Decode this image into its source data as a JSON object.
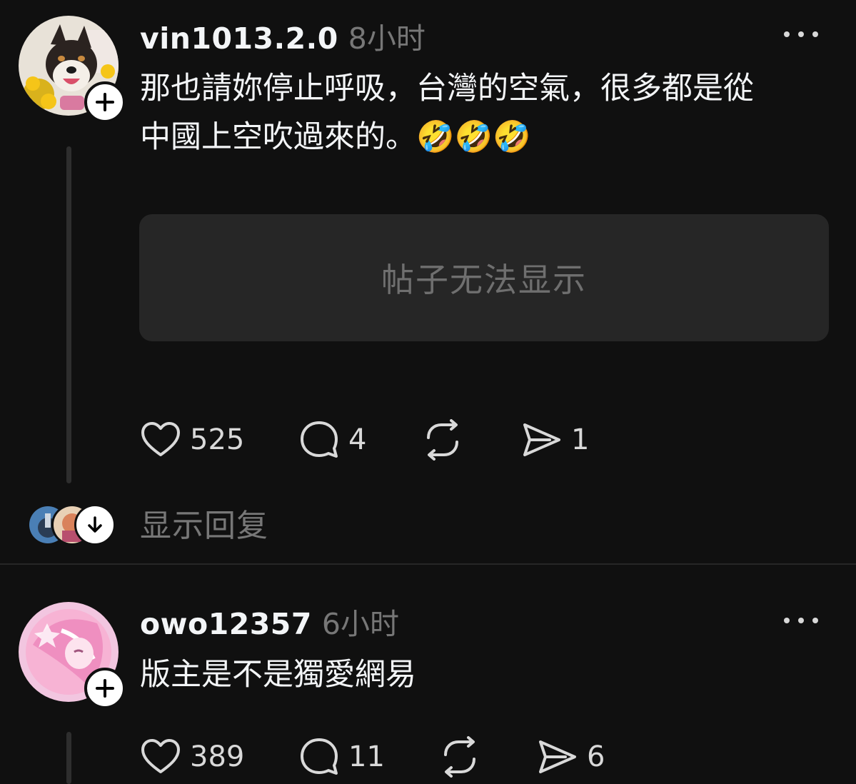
{
  "posts": [
    {
      "username": "vin1013.2.0",
      "time": "8小时",
      "text_line1": "那也請妳停止呼吸，台灣的空氣，很多都是從",
      "text_line2": "中國上空吹過來的。",
      "emojis": "🤣🤣🤣",
      "embedded_notice": "帖子无法显示",
      "likes": "525",
      "comments": "4",
      "reposts": "",
      "shares": "1",
      "show_replies_label": "显示回复"
    },
    {
      "username": "owo12357",
      "time": "6小时",
      "text": "版主是不是獨愛網易",
      "likes": "389",
      "comments": "11",
      "reposts": "",
      "shares": "6"
    }
  ],
  "icons": {
    "like": "heart-icon",
    "comment": "comment-bubble-icon",
    "repost": "repost-icon",
    "share": "send-icon",
    "follow": "plus-icon",
    "more": "more-dots-icon",
    "expand": "arrow-down-icon"
  },
  "colors": {
    "background": "#101010",
    "text": "#f3f5f7",
    "muted": "#777777",
    "card": "#262626"
  }
}
